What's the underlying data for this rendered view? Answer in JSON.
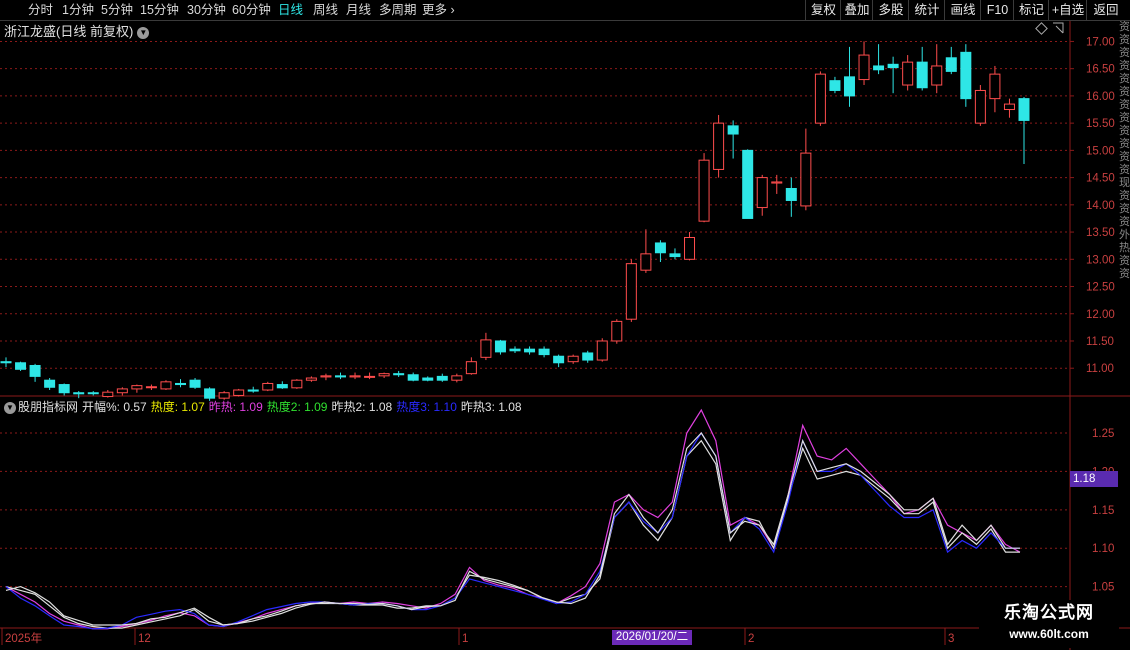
{
  "toolbar": {
    "periods": [
      "分时",
      "1分钟",
      "5分钟",
      "15分钟",
      "30分钟",
      "60分钟",
      "日线",
      "周线",
      "月线",
      "多周期",
      "更多"
    ],
    "active_period": "日线",
    "right_buttons": [
      "复权",
      "叠加",
      "多股",
      "统计",
      "画线",
      "F10",
      "标记",
      "+自选",
      "返回"
    ]
  },
  "main": {
    "title": "浙江龙盛(日线 前复权)",
    "price_axis": [
      "17.00",
      "16.50",
      "16.00",
      "15.50",
      "15.00",
      "14.50",
      "14.00",
      "13.50",
      "13.00",
      "12.50",
      "12.00",
      "11.50",
      "11.00"
    ]
  },
  "indicator": {
    "name": "股朋指标网",
    "open_label": "开幅%: 0.57",
    "items": [
      {
        "label": "热度: 1.07",
        "color": "#e8e800"
      },
      {
        "label": "昨热: 1.09",
        "color": "#e040e0"
      },
      {
        "label": "热度2: 1.09",
        "color": "#30e030"
      },
      {
        "label": "昨热2: 1.08",
        "color": "#e0e0e0"
      },
      {
        "label": "热度3: 1.10",
        "color": "#2a2aff"
      },
      {
        "label": "昨热3: 1.08",
        "color": "#e0e0e0"
      }
    ],
    "axis": [
      "1.25",
      "1.20",
      "1.15",
      "1.10",
      "1.05"
    ],
    "current_badge": "1.18"
  },
  "date_axis": {
    "labels": [
      "2025年",
      "12",
      "1",
      "2",
      "3"
    ],
    "cursor_date": "2026/01/20/二"
  },
  "right_strip_text": "资资资资资资资资资资资资现资资资外热资资",
  "watermark": {
    "title": "乐淘公式网",
    "url": "www.60lt.com"
  },
  "colors": {
    "up": "#ff4d4d",
    "down": "#2ee6e6",
    "grid": "#8b1a1a",
    "bg": "#000000"
  },
  "chart_data": [
    {
      "type": "candlestick",
      "title": "浙江龙盛(日线 前复权)",
      "ylim": [
        10.6,
        17.1
      ],
      "candles": [
        [
          11.12,
          11.2,
          11.02,
          11.1
        ],
        [
          11.1,
          11.12,
          10.95,
          10.98
        ],
        [
          11.05,
          11.08,
          10.75,
          10.85
        ],
        [
          10.78,
          10.82,
          10.6,
          10.65
        ],
        [
          10.7,
          10.72,
          10.5,
          10.55
        ],
        [
          10.55,
          10.58,
          10.45,
          10.53
        ],
        [
          10.55,
          10.58,
          10.5,
          10.54
        ],
        [
          10.48,
          10.6,
          10.46,
          10.56
        ],
        [
          10.55,
          10.65,
          10.5,
          10.62
        ],
        [
          10.62,
          10.7,
          10.55,
          10.68
        ],
        [
          10.65,
          10.7,
          10.6,
          10.66
        ],
        [
          10.62,
          10.78,
          10.6,
          10.75
        ],
        [
          10.72,
          10.8,
          10.65,
          10.7
        ],
        [
          10.78,
          10.82,
          10.62,
          10.65
        ],
        [
          10.62,
          10.65,
          10.4,
          10.45
        ],
        [
          10.45,
          10.58,
          10.42,
          10.55
        ],
        [
          10.5,
          10.62,
          10.48,
          10.6
        ],
        [
          10.6,
          10.66,
          10.55,
          10.58
        ],
        [
          10.6,
          10.75,
          10.58,
          10.72
        ],
        [
          10.7,
          10.76,
          10.62,
          10.64
        ],
        [
          10.64,
          10.8,
          10.62,
          10.78
        ],
        [
          10.78,
          10.85,
          10.75,
          10.82
        ],
        [
          10.84,
          10.9,
          10.78,
          10.86
        ],
        [
          10.86,
          10.92,
          10.8,
          10.84
        ],
        [
          10.84,
          10.92,
          10.8,
          10.86
        ],
        [
          10.84,
          10.92,
          10.8,
          10.85
        ],
        [
          10.86,
          10.92,
          10.82,
          10.9
        ],
        [
          10.9,
          10.95,
          10.84,
          10.88
        ],
        [
          10.88,
          10.92,
          10.76,
          10.78
        ],
        [
          10.82,
          10.85,
          10.76,
          10.78
        ],
        [
          10.85,
          10.9,
          10.75,
          10.78
        ],
        [
          10.78,
          10.9,
          10.74,
          10.86
        ],
        [
          10.9,
          11.2,
          10.88,
          11.12
        ],
        [
          11.2,
          11.65,
          11.15,
          11.52
        ],
        [
          11.5,
          11.52,
          11.25,
          11.3
        ],
        [
          11.35,
          11.4,
          11.28,
          11.32
        ],
        [
          11.35,
          11.4,
          11.25,
          11.3
        ],
        [
          11.35,
          11.4,
          11.2,
          11.25
        ],
        [
          11.22,
          11.25,
          11.02,
          11.1
        ],
        [
          11.12,
          11.25,
          11.08,
          11.22
        ],
        [
          11.28,
          11.32,
          11.1,
          11.15
        ],
        [
          11.15,
          11.55,
          11.12,
          11.5
        ],
        [
          11.5,
          11.9,
          11.45,
          11.86
        ],
        [
          11.9,
          13.0,
          11.85,
          12.92
        ],
        [
          12.8,
          13.55,
          12.75,
          13.1
        ],
        [
          13.3,
          13.35,
          12.95,
          13.12
        ],
        [
          13.1,
          13.2,
          13.0,
          13.05
        ],
        [
          13.0,
          13.5,
          12.98,
          13.4
        ],
        [
          13.7,
          14.95,
          13.68,
          14.82
        ],
        [
          14.65,
          15.65,
          14.5,
          15.5
        ],
        [
          15.45,
          15.55,
          14.85,
          15.3
        ],
        [
          15.0,
          15.02,
          13.75,
          13.75
        ],
        [
          13.95,
          14.55,
          13.8,
          14.5
        ],
        [
          14.4,
          14.55,
          14.2,
          14.42
        ],
        [
          14.3,
          14.5,
          13.78,
          14.08
        ],
        [
          13.98,
          15.4,
          13.9,
          14.95
        ],
        [
          15.5,
          16.45,
          15.45,
          16.4
        ],
        [
          16.28,
          16.35,
          16.05,
          16.1
        ],
        [
          16.35,
          16.9,
          15.8,
          16.0
        ],
        [
          16.3,
          17.0,
          16.2,
          16.75
        ],
        [
          16.55,
          16.95,
          16.4,
          16.48
        ],
        [
          16.58,
          16.72,
          16.05,
          16.52
        ],
        [
          16.2,
          16.75,
          16.1,
          16.62
        ],
        [
          16.62,
          16.9,
          16.1,
          16.15
        ],
        [
          16.2,
          16.95,
          16.05,
          16.55
        ],
        [
          16.7,
          16.9,
          16.4,
          16.45
        ],
        [
          16.8,
          16.95,
          15.8,
          15.95
        ],
        [
          15.5,
          16.2,
          15.45,
          16.1
        ],
        [
          15.95,
          16.55,
          15.7,
          16.4
        ],
        [
          15.75,
          15.95,
          15.6,
          15.85
        ],
        [
          15.95,
          15.98,
          14.75,
          15.55
        ]
      ]
    },
    {
      "type": "line",
      "ylim": [
        1.0,
        1.28
      ],
      "series": [
        {
          "name": "热度",
          "color": "#e8e800",
          "values": []
        },
        {
          "name": "昨热",
          "color": "#e040e0",
          "values": [
            1.05,
            1.04,
            1.03,
            1.015,
            1.005,
            1.0,
            0.995,
            0.995,
            0.998,
            1.002,
            1.006,
            1.012,
            1.016,
            1.012,
            1.0,
            0.998,
            1.003,
            1.008,
            1.015,
            1.02,
            1.025,
            1.028,
            1.03,
            1.028,
            1.03,
            1.028,
            1.03,
            1.028,
            1.025,
            1.022,
            1.028,
            1.04,
            1.075,
            1.058,
            1.052,
            1.048,
            1.04,
            1.035,
            1.028,
            1.038,
            1.05,
            1.08,
            1.16,
            1.17,
            1.15,
            1.14,
            1.16,
            1.25,
            1.28,
            1.24,
            1.13,
            1.14,
            1.13,
            1.1,
            1.17,
            1.26,
            1.22,
            1.215,
            1.23,
            1.21,
            1.19,
            1.17,
            1.145,
            1.15,
            1.165,
            1.13,
            1.12,
            1.11,
            1.13,
            1.105,
            1.095
          ]
        },
        {
          "name": "热度2",
          "color": "#30e030",
          "values": []
        },
        {
          "name": "昨热2",
          "color": "#e0e0e0",
          "values": [
            1.05,
            1.045,
            1.04,
            1.025,
            1.01,
            1.002,
            0.998,
            0.996,
            0.996,
            1.0,
            1.004,
            1.008,
            1.012,
            1.02,
            1.005,
            1.0,
            1.002,
            1.008,
            1.012,
            1.018,
            1.025,
            1.028,
            1.028,
            1.028,
            1.026,
            1.026,
            1.026,
            1.022,
            1.022,
            1.025,
            1.025,
            1.035,
            1.065,
            1.062,
            1.058,
            1.052,
            1.045,
            1.035,
            1.028,
            1.035,
            1.04,
            1.06,
            1.14,
            1.16,
            1.13,
            1.11,
            1.14,
            1.22,
            1.24,
            1.21,
            1.11,
            1.14,
            1.135,
            1.1,
            1.165,
            1.23,
            1.19,
            1.195,
            1.2,
            1.195,
            1.18,
            1.165,
            1.145,
            1.145,
            1.16,
            1.1,
            1.12,
            1.105,
            1.125,
            1.095,
            1.095
          ]
        },
        {
          "name": "热度3",
          "color": "#2a2aff",
          "values": [
            1.05,
            1.035,
            1.025,
            1.012,
            1.0,
            0.998,
            0.995,
            0.996,
            1.0,
            1.01,
            1.014,
            1.018,
            1.02,
            1.015,
            1.0,
            0.998,
            1.004,
            1.012,
            1.02,
            1.024,
            1.028,
            1.03,
            1.03,
            1.028,
            1.026,
            1.028,
            1.028,
            1.025,
            1.02,
            1.02,
            1.025,
            1.035,
            1.06,
            1.055,
            1.05,
            1.045,
            1.04,
            1.034,
            1.028,
            1.03,
            1.04,
            1.07,
            1.14,
            1.16,
            1.135,
            1.12,
            1.14,
            1.22,
            1.25,
            1.22,
            1.12,
            1.14,
            1.125,
            1.095,
            1.16,
            1.24,
            1.2,
            1.2,
            1.21,
            1.195,
            1.175,
            1.155,
            1.14,
            1.14,
            1.15,
            1.095,
            1.11,
            1.1,
            1.12,
            1.1,
            1.1
          ]
        },
        {
          "name": "昨热3",
          "color": "#e0e0e0",
          "values": [
            1.045,
            1.05,
            1.042,
            1.03,
            1.012,
            1.006,
            1.0,
            1.0,
            1.0,
            1.002,
            1.008,
            1.01,
            1.016,
            1.022,
            1.01,
            1.0,
            1.002,
            1.005,
            1.01,
            1.015,
            1.022,
            1.027,
            1.03,
            1.028,
            1.028,
            1.027,
            1.028,
            1.025,
            1.02,
            1.024,
            1.025,
            1.032,
            1.07,
            1.06,
            1.055,
            1.05,
            1.045,
            1.036,
            1.03,
            1.028,
            1.035,
            1.065,
            1.145,
            1.17,
            1.14,
            1.12,
            1.15,
            1.23,
            1.25,
            1.22,
            1.12,
            1.135,
            1.13,
            1.105,
            1.17,
            1.24,
            1.2,
            1.205,
            1.21,
            1.2,
            1.185,
            1.17,
            1.15,
            1.15,
            1.165,
            1.105,
            1.13,
            1.11,
            1.13,
            1.1,
            1.1
          ]
        }
      ]
    }
  ]
}
